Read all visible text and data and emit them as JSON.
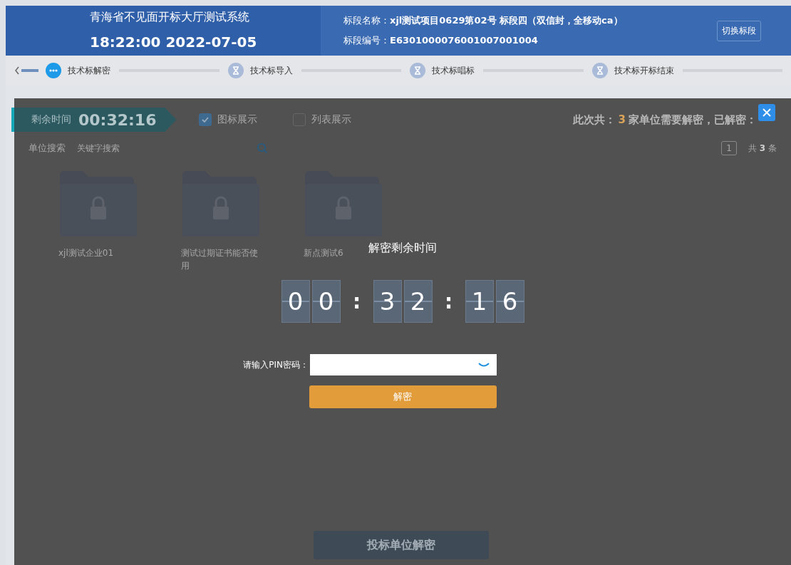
{
  "header": {
    "system_title": "青海省不见面开标大厅测试系统",
    "datetime": "18:22:00 2022-07-05",
    "section_name_label": "标段名称：",
    "section_name": "xjl测试项目0629第02号 标段四（双信封，全移动ca）",
    "section_code_label": "标段编号：",
    "section_code": "E6301000076001007001004",
    "switch_button": "切换标段"
  },
  "steps": [
    {
      "label": "技术标解密",
      "selected": true
    },
    {
      "label": "技术标导入",
      "selected": false
    },
    {
      "label": "技术标唱标",
      "selected": false
    },
    {
      "label": "技术标开标结束",
      "selected": false
    }
  ],
  "background": {
    "timer_label": "剩余时间",
    "timer_value": "00:32:16",
    "view_options": [
      {
        "label": "图标展示",
        "checked": true
      },
      {
        "label": "列表展示",
        "checked": false
      }
    ],
    "summary": {
      "prefix": "此次共：",
      "count": "3",
      "suffix": "家单位需要解密，已解密："
    },
    "search_label": "单位搜索",
    "search_placeholder": "关键字搜索",
    "page": "1",
    "total_prefix": "共",
    "total_count": "3",
    "total_suffix": "条",
    "bidders": [
      {
        "name": "xjl测试企业01"
      },
      {
        "name": "测试过期证书能否使用"
      },
      {
        "name": "新点测试6"
      }
    ],
    "bottom_button": "投标单位解密"
  },
  "dialog": {
    "title": "解密剩余时间",
    "groups": [
      [
        "0",
        "0"
      ],
      [
        "3",
        "2"
      ],
      [
        "1",
        "6"
      ]
    ],
    "separators": [
      ":",
      ":"
    ],
    "pin_label": "请输入PIN密码：",
    "decrypt_button": "解密"
  }
}
